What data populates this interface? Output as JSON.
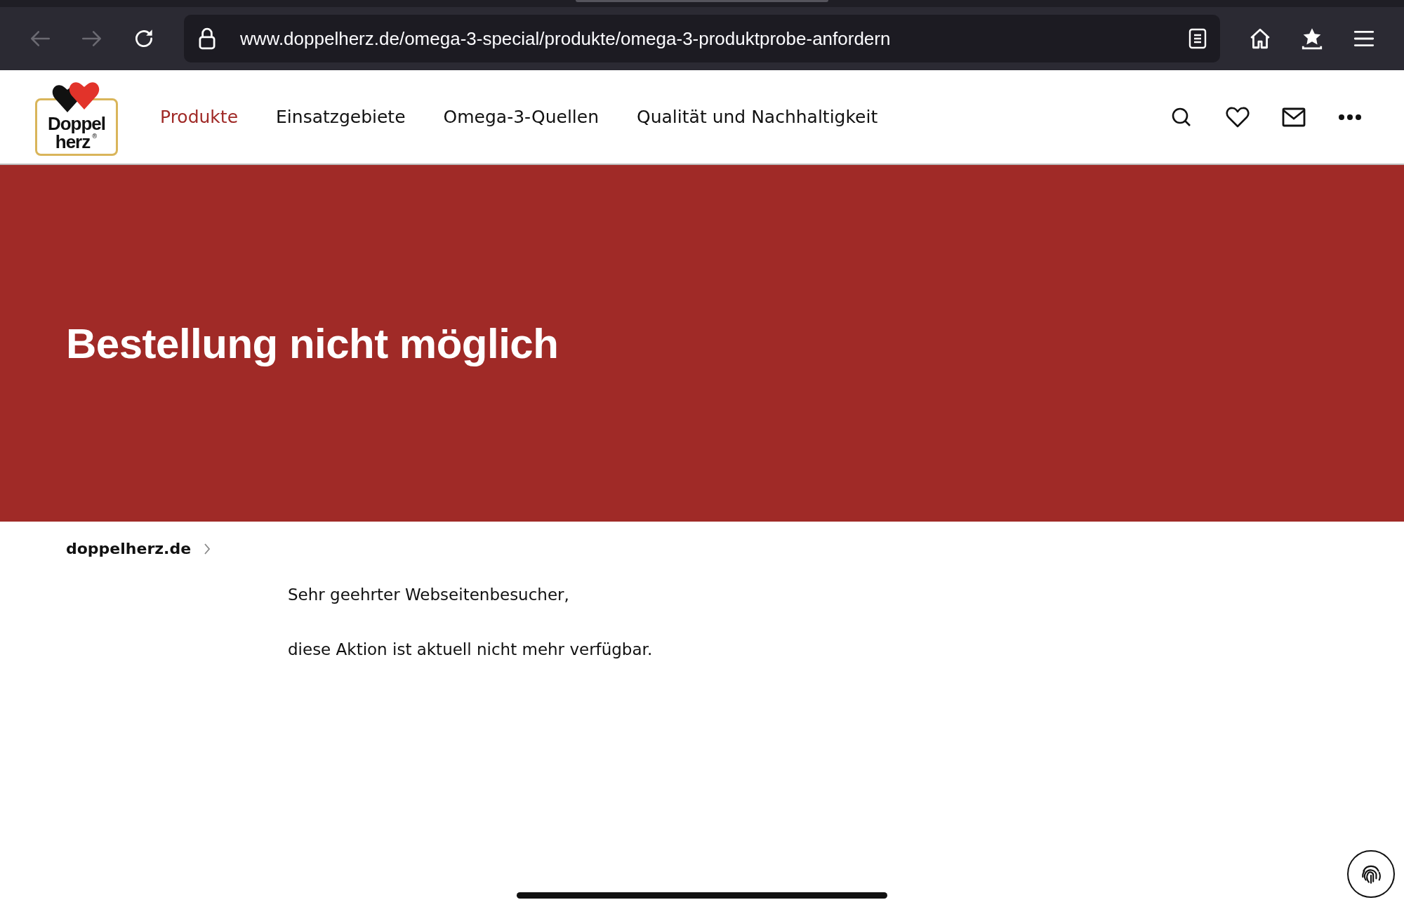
{
  "browser": {
    "url": "www.doppelherz.de/omega-3-special/produkte/omega-3-produktprobe-anfordern"
  },
  "logo": {
    "line_1": "Doppel",
    "line_2": "herz",
    "mark": "®"
  },
  "nav": [
    {
      "label": "Produkte",
      "selected": true
    },
    {
      "label": "Einsatzgebiete",
      "selected": false
    },
    {
      "label": "Omega-3-Quellen",
      "selected": false
    },
    {
      "label": "Qualität und Nachhaltigkeit",
      "selected": false
    }
  ],
  "hero": {
    "title": "Bestellung nicht möglich"
  },
  "breadcrumb": [
    {
      "label": "doppelherz.de"
    }
  ],
  "message": [
    "Sehr geehrter Webseitenbesucher,",
    "diese Aktion ist aktuell nicht mehr verfügbar."
  ]
}
